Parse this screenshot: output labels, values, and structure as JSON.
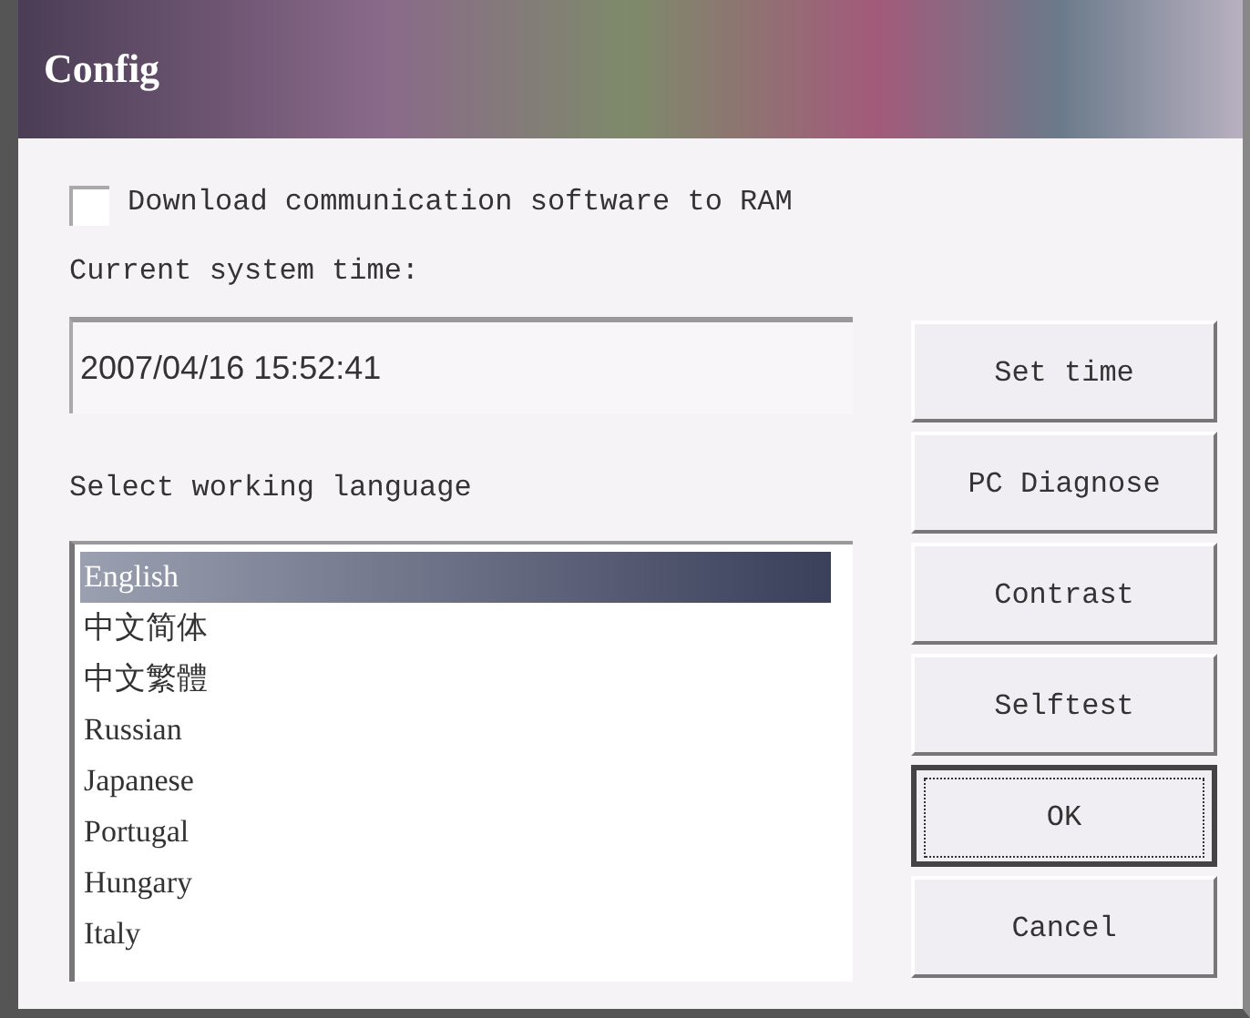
{
  "window": {
    "title": "Config"
  },
  "download_option": {
    "label": "Download communication software to RAM",
    "checked": false
  },
  "time": {
    "label": "Current system time:",
    "value": "2007/04/16 15:52:41"
  },
  "language": {
    "label": "Select working language",
    "items": [
      {
        "label": "English",
        "selected": true
      },
      {
        "label": "中文简体",
        "selected": false
      },
      {
        "label": "中文繁體",
        "selected": false
      },
      {
        "label": "Russian",
        "selected": false
      },
      {
        "label": "Japanese",
        "selected": false
      },
      {
        "label": "Portugal",
        "selected": false
      },
      {
        "label": "Hungary",
        "selected": false
      },
      {
        "label": "Italy",
        "selected": false
      }
    ]
  },
  "buttons": [
    {
      "label": "Set time",
      "focused": false
    },
    {
      "label": "PC Diagnose",
      "focused": false
    },
    {
      "label": "Contrast",
      "focused": false
    },
    {
      "label": "Selftest",
      "focused": false
    },
    {
      "label": "OK",
      "focused": true
    },
    {
      "label": "Cancel",
      "focused": false
    }
  ]
}
